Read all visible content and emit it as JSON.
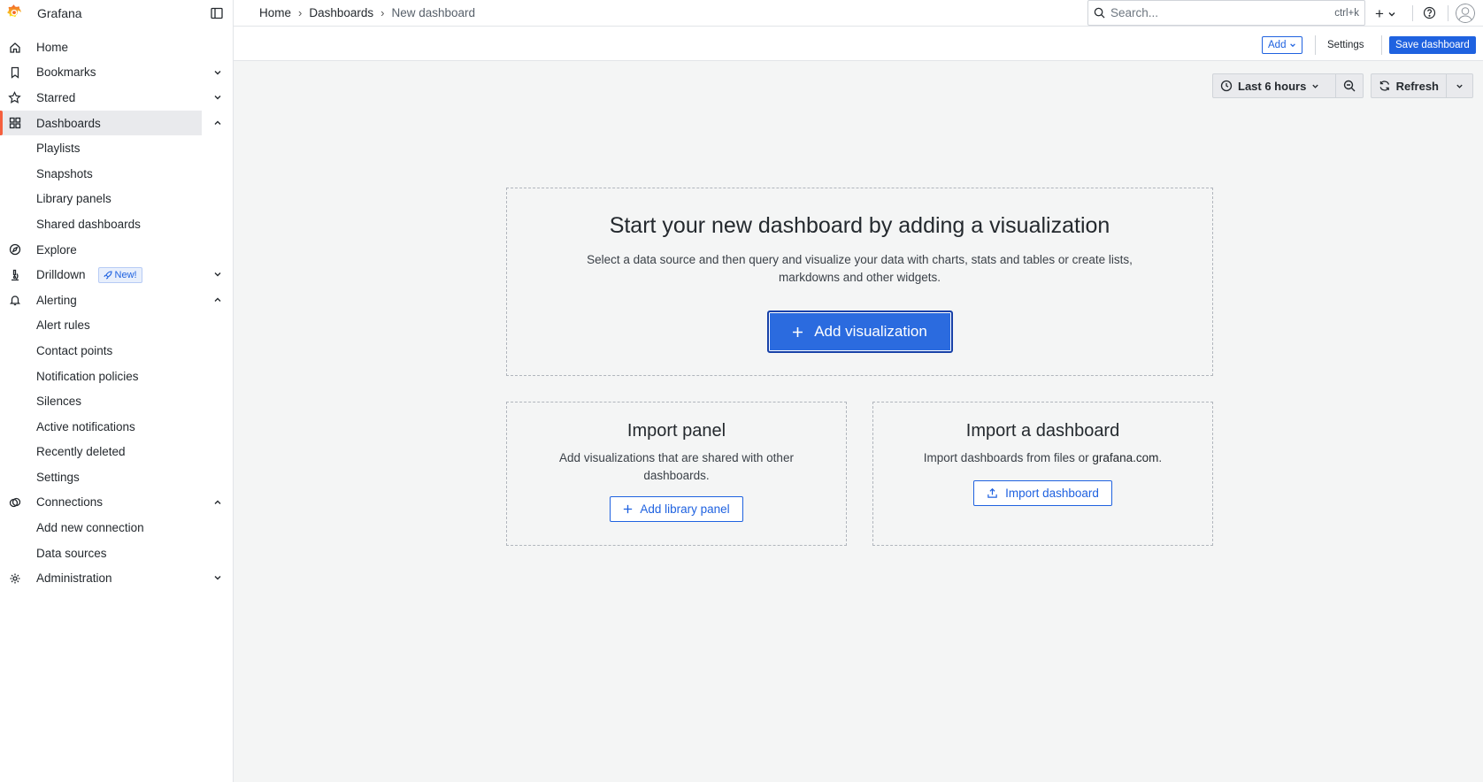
{
  "app": {
    "name": "Grafana"
  },
  "sidebar": {
    "items": [
      {
        "label": "Home",
        "icon": "home-icon",
        "chevron": ""
      },
      {
        "label": "Bookmarks",
        "icon": "bookmark-icon",
        "chevron": "down"
      },
      {
        "label": "Starred",
        "icon": "star-icon",
        "chevron": "down"
      },
      {
        "label": "Dashboards",
        "icon": "apps-icon",
        "chevron": "up",
        "active": true
      },
      {
        "label": "Playlists",
        "sub": true
      },
      {
        "label": "Snapshots",
        "sub": true
      },
      {
        "label": "Library panels",
        "sub": true
      },
      {
        "label": "Shared dashboards",
        "sub": true
      },
      {
        "label": "Explore",
        "icon": "compass-icon",
        "chevron": ""
      },
      {
        "label": "Drilldown",
        "icon": "microscope-icon",
        "chevron": "down",
        "badge": "New!"
      },
      {
        "label": "Alerting",
        "icon": "bell-icon",
        "chevron": "up"
      },
      {
        "label": "Alert rules",
        "sub": true
      },
      {
        "label": "Contact points",
        "sub": true
      },
      {
        "label": "Notification policies",
        "sub": true
      },
      {
        "label": "Silences",
        "sub": true
      },
      {
        "label": "Active notifications",
        "sub": true
      },
      {
        "label": "Recently deleted",
        "sub": true
      },
      {
        "label": "Settings",
        "sub": true
      },
      {
        "label": "Connections",
        "icon": "connections-icon",
        "chevron": "up"
      },
      {
        "label": "Add new connection",
        "sub": true
      },
      {
        "label": "Data sources",
        "sub": true
      },
      {
        "label": "Administration",
        "icon": "cog-icon",
        "chevron": "down"
      }
    ]
  },
  "topbar": {
    "breadcrumb": [
      "Home",
      "Dashboards",
      "New dashboard"
    ],
    "search_placeholder": "Search...",
    "search_shortcut": "ctrl+k",
    "plus_label": "+"
  },
  "toolbar": {
    "add_label": "Add",
    "settings_label": "Settings",
    "save_label": "Save dashboard"
  },
  "time": {
    "range_label": "Last 6 hours",
    "refresh_label": "Refresh"
  },
  "main": {
    "title": "Start your new dashboard by adding a visualization",
    "description": "Select a data source and then query and visualize your data with charts, stats and tables or create lists, markdowns and other widgets.",
    "add_viz_label": "Add visualization"
  },
  "import_panel": {
    "title": "Import panel",
    "description": "Add visualizations that are shared with other dashboards.",
    "button_label": "Add library panel"
  },
  "import_dashboard": {
    "title": "Import a dashboard",
    "description_prefix": "Import dashboards from files or ",
    "description_link": "grafana.com",
    "description_suffix": ".",
    "button_label": "Import dashboard"
  },
  "colors": {
    "accent": "#1f62e0",
    "active_indicator": "#f55f3e",
    "background": "#f4f5f5"
  }
}
